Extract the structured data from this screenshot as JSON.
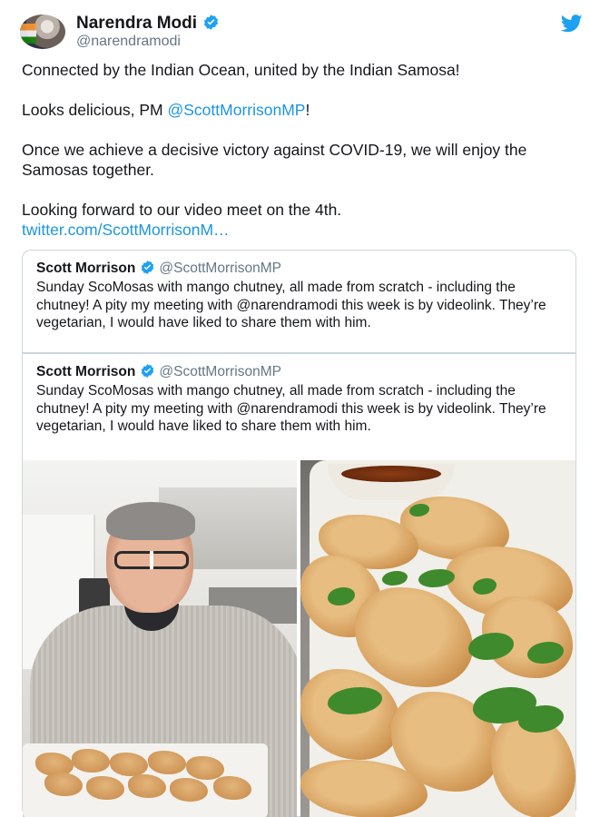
{
  "tweet": {
    "author_name": "Narendra Modi",
    "author_handle": "@narendramodi",
    "icons": {
      "avatar": "avatar",
      "verified": "verified-badge-icon",
      "brand": "twitter-bird-icon"
    },
    "colors": {
      "link": "#1b95e0",
      "verified": "#1da1f2",
      "brand": "#1da1f2",
      "secondary_text": "#657786"
    },
    "paragraph_1": "Connected by the Indian Ocean, united by the Indian Samosa!",
    "paragraph_2_prefix": "Looks delicious, PM ",
    "paragraph_2_mention": "@ScottMorrisonMP",
    "paragraph_2_suffix": "!",
    "paragraph_3": "Once we achieve a decisive victory against COVID-19, we will enjoy the Samosas together.",
    "paragraph_4": "Looking forward to our video meet on the 4th.",
    "link": "twitter.com/ScottMorrisonM…"
  },
  "quoted_tweet": {
    "author_name": "Scott Morrison",
    "author_handle": "@ScottMorrisonMP",
    "text": "Sunday ScoMosas with mango chutney, all made from scratch - including the chutney! A pity my meeting with @narendramodi this week is by videolink. They’re vegetarian, I would have liked to share them with him."
  }
}
